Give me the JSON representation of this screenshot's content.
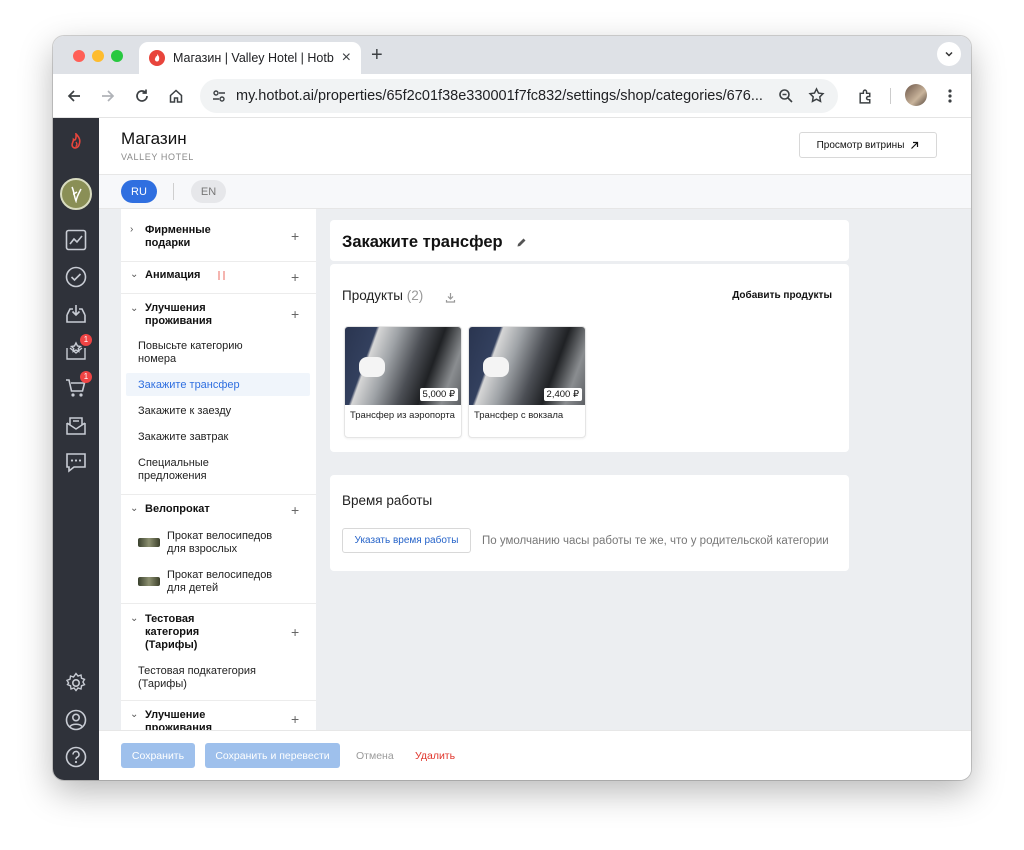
{
  "browser": {
    "tab_title": "Магазин | Valley Hotel | Hotbot",
    "url": "my.hotbot.ai/properties/65f2c01f38e330001f7fc832/settings/shop/categories/676..."
  },
  "sidebar": {
    "badges": {
      "reviews": "1",
      "shop": "1"
    }
  },
  "header": {
    "title": "Магазин",
    "subtitle": "VALLEY HOTEL",
    "showcase_label": "Просмотр витрины"
  },
  "languages": {
    "active": "RU",
    "inactive": "EN"
  },
  "categories": {
    "gifts": "Фирменные подарки",
    "animation": "Анимация",
    "upgrades": "Улучшения проживания",
    "upgrades_items": [
      "Повысьте категорию номера",
      "Закажите трансфер",
      "Закажите к заезду",
      "Закажите завтрак",
      "Специальные предложения"
    ],
    "bike": "Велопрокат",
    "bike_items": [
      "Прокат велосипедов для взрослых",
      "Прокат велосипедов для детей"
    ],
    "test": "Тестовая категория (Тарифы)",
    "test_items": [
      "Тестовая подкатегория (Тарифы)"
    ],
    "upgrade_single": "Улучшение проживания"
  },
  "editor": {
    "category_title": "Закажите трансфер",
    "products_label": "Продукты",
    "products_count": "(2)",
    "add_products": "Добавить продукты",
    "products": [
      {
        "name": "Трансфер из аэропорта",
        "price": "5,000 ₽"
      },
      {
        "name": "Трансфер с вокзала",
        "price": "2,400 ₽"
      }
    ],
    "hours_title": "Время работы",
    "hours_button": "Указать время работы",
    "hours_note": "По умолчанию часы работы те же, что у родительской категории"
  },
  "footer": {
    "save": "Сохранить",
    "save_translate": "Сохранить и перевести",
    "cancel": "Отмена",
    "delete": "Удалить"
  },
  "colors": {
    "accent": "#2f6fe0",
    "sidebar": "#2f323a",
    "danger": "#e0352b",
    "disabled_button": "#9ec0ec"
  }
}
